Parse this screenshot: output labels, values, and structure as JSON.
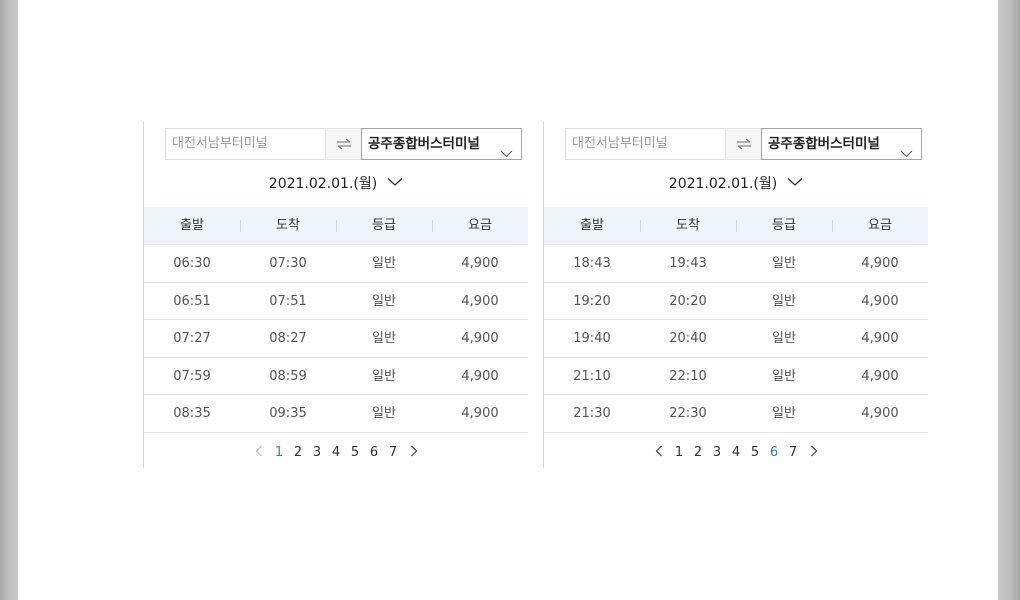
{
  "panels": [
    {
      "from_placeholder": "대전서남부터미널",
      "to_terminal": "공주종합버스터미널",
      "date": "2021.02.01.(월)",
      "columns": [
        "출발",
        "도착",
        "등급",
        "요금"
      ],
      "rows": [
        [
          "06:30",
          "07:30",
          "일반",
          "4,900"
        ],
        [
          "06:51",
          "07:51",
          "일반",
          "4,900"
        ],
        [
          "07:27",
          "08:27",
          "일반",
          "4,900"
        ],
        [
          "07:59",
          "08:59",
          "일반",
          "4,900"
        ],
        [
          "08:35",
          "09:35",
          "일반",
          "4,900"
        ]
      ],
      "pages": [
        "1",
        "2",
        "3",
        "4",
        "5",
        "6",
        "7"
      ],
      "current_page": "1",
      "prev_enabled": false
    },
    {
      "from_placeholder": "대전서남부터미널",
      "to_terminal": "공주종합버스터미널",
      "date": "2021.02.01.(월)",
      "columns": [
        "출발",
        "도착",
        "등급",
        "요금"
      ],
      "rows": [
        [
          "18:43",
          "19:43",
          "일반",
          "4,900"
        ],
        [
          "19:20",
          "20:20",
          "일반",
          "4,900"
        ],
        [
          "19:40",
          "20:40",
          "일반",
          "4,900"
        ],
        [
          "21:10",
          "22:10",
          "일반",
          "4,900"
        ],
        [
          "21:30",
          "22:30",
          "일반",
          "4,900"
        ]
      ],
      "pages": [
        "1",
        "2",
        "3",
        "4",
        "5",
        "6",
        "7"
      ],
      "current_page": "6",
      "prev_enabled": true
    }
  ],
  "icons": {
    "swap": "swap-arrows-icon",
    "dropdown": "chevron-down-icon",
    "prev": "chevron-left-icon",
    "next": "chevron-right-icon"
  },
  "colors": {
    "header_bg": "#eef4fa",
    "active_page": "#2a7fd4",
    "disabled_arrow": "#bbbbbb"
  }
}
